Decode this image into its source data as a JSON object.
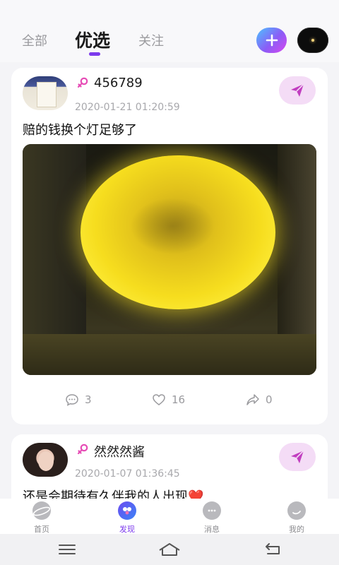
{
  "header": {
    "tabs": [
      {
        "label": "全部",
        "active": false
      },
      {
        "label": "优选",
        "active": true
      },
      {
        "label": "关注",
        "active": false
      }
    ],
    "add_icon": "plus-icon",
    "accent_color": "#7c3aed"
  },
  "posts": [
    {
      "username": "456789",
      "gender_icon": "female-icon",
      "timestamp": "2020-01-21 01:20:59",
      "text": "赔的钱换个灯足够了",
      "image": "photo-moon-lamp",
      "comments": "3",
      "likes": "16",
      "shares": "0"
    },
    {
      "username": "然然然酱",
      "gender_icon": "female-icon",
      "timestamp": "2020-01-07 01:36:45",
      "text": "还是会期待有久伴我的人出现❤️"
    }
  ],
  "bottom_nav": [
    {
      "label": "首页",
      "icon": "planet-icon",
      "active": false
    },
    {
      "label": "发现",
      "icon": "discover-icon",
      "active": true
    },
    {
      "label": "消息",
      "icon": "chat-icon",
      "active": false
    },
    {
      "label": "我的",
      "icon": "profile-icon",
      "active": false
    }
  ],
  "system_nav": [
    "menu-icon",
    "home-icon",
    "back-icon"
  ]
}
